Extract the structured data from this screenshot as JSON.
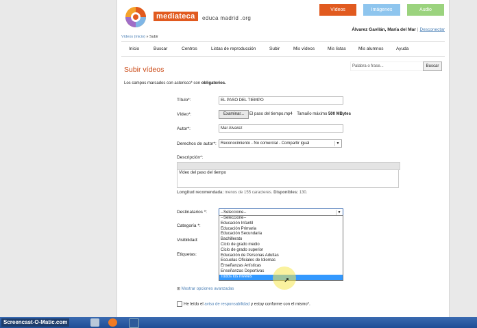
{
  "brand": {
    "name": "mediateca",
    "sub": "educa madrid .org"
  },
  "top_buttons": {
    "videos": "Vídeos",
    "imagenes": "Imágenes",
    "audio": "Audio"
  },
  "colors": {
    "accent": "#e15a1f",
    "imagenes": "#8ec5ee",
    "audio": "#9bd37e",
    "link": "#4a7fb5",
    "highlight": "#3399ff"
  },
  "user": {
    "name": "Álvarez Gavilán, María del Mar",
    "logout": "Desconectar"
  },
  "breadcrumb": {
    "home": "Vídeos (inicio)",
    "sep": "»",
    "current": "Subir"
  },
  "menu": [
    "Inicio",
    "Buscar",
    "Centros",
    "Listas de reproducción",
    "Subir",
    "Mis vídeos",
    "Mis listas",
    "Mis alumnos",
    "Ayuda"
  ],
  "page": {
    "title": "Subir vídeos",
    "intro_prefix": "Los campos marcados con asterisco* son ",
    "intro_bold": "obligatorios."
  },
  "search": {
    "placeholder": "Palabra o frase...",
    "button": "Buscar"
  },
  "form": {
    "titulo_label": "Título*:",
    "titulo_value": "EL PASO DEL TIEMPO",
    "video_label": "Vídeo*:",
    "browse": "Examinar...",
    "filename": "El paso del tiempo.mp4",
    "size_prefix": "Tamaño máximo ",
    "size_value": "500 MBytes",
    "autor_label": "Autor*:",
    "autor_value": "Mar Alvarez",
    "derechos_label": "Derechos de autor*:",
    "derechos_value": "Reconocimiento - No comercial - Compartir igual",
    "descripcion_label": "Descripción*:",
    "descripcion_value": "Video del paso del tiempo",
    "longitud_prefix": "Longitud recomendada:",
    "longitud_mid": " menos de 155 caracteres. ",
    "longitud_disp_label": "Disponibles:",
    "longitud_disp_value": " 130.",
    "destinatarios_label": "Destinatarios *:",
    "destinatarios_value": "--Seleccione--",
    "categoria_label": "Categoría *:",
    "visibilidad_label": "Visibilidad:",
    "etiquetas_label": "Etiquetas:",
    "advanced": "Mostrar opciones avanzadas",
    "terms_prefix": "He leído el ",
    "terms_link": "aviso de responsabilidad",
    "terms_suffix": " y estoy conforme con el mismo*."
  },
  "dropdown_options": [
    "--Seleccione--",
    "Educación Infantil",
    "Educación Primaria",
    "Educación Secundaria",
    "Bachillerato",
    "Ciclo de grado medio",
    "Ciclo de grado superior",
    "Educación de Personas Adultas",
    "Escuelas Oficiales de Idiomas",
    "Enseñanzas Artísticas",
    "Enseñanzas Deportivas",
    "Todos los niveles"
  ],
  "dropdown_highlighted": "Todos los niveles",
  "taskbar": {
    "brand": "Screencast-O-Matic.com"
  }
}
